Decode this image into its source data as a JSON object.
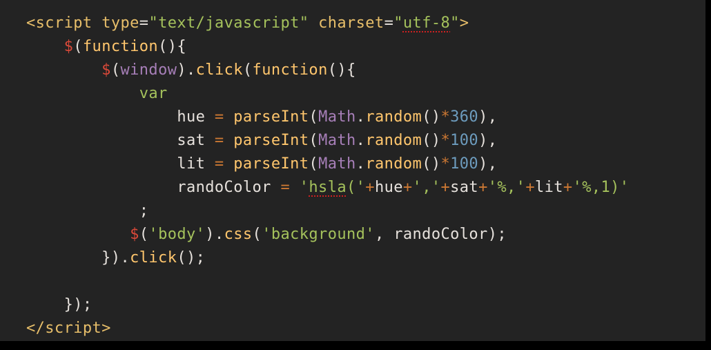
{
  "colors": {
    "window_background": "#232323",
    "outer_background": "#000000",
    "plain_text": "#e6e1dc",
    "tag": "#e8bf6a",
    "string": "#a5c25c",
    "keyword": "#cc7833",
    "number": "#6d9cbe",
    "global": "#a77fb8",
    "spellcheck_underline": "#d02020"
  },
  "lines": [
    [
      {
        "t": "<script",
        "c": "tag"
      },
      {
        "t": " ",
        "c": "plain"
      },
      {
        "t": "type",
        "c": "attr"
      },
      {
        "t": "=",
        "c": "plain"
      },
      {
        "t": "\"text/javascript\"",
        "c": "string"
      },
      {
        "t": " ",
        "c": "plain"
      },
      {
        "t": "charset",
        "c": "attr"
      },
      {
        "t": "=",
        "c": "plain"
      },
      {
        "t": "\"",
        "c": "string"
      },
      {
        "t": "utf-8",
        "c": "string",
        "spell": true
      },
      {
        "t": "\"",
        "c": "string"
      },
      {
        "t": ">",
        "c": "tag"
      }
    ],
    [
      {
        "t": "    ",
        "c": "plain"
      },
      {
        "t": "$",
        "c": "dollar"
      },
      {
        "t": "(",
        "c": "punct"
      },
      {
        "t": "function",
        "c": "func"
      },
      {
        "t": "(){",
        "c": "punct"
      }
    ],
    [
      {
        "t": "        ",
        "c": "plain"
      },
      {
        "t": "$",
        "c": "dollar"
      },
      {
        "t": "(",
        "c": "punct"
      },
      {
        "t": "window",
        "c": "global"
      },
      {
        "t": ").",
        "c": "punct"
      },
      {
        "t": "click",
        "c": "builtin"
      },
      {
        "t": "(",
        "c": "punct"
      },
      {
        "t": "function",
        "c": "func"
      },
      {
        "t": "(){",
        "c": "punct"
      }
    ],
    [
      {
        "t": "            ",
        "c": "plain"
      },
      {
        "t": "var",
        "c": "decl"
      }
    ],
    [
      {
        "t": "                ",
        "c": "plain"
      },
      {
        "t": "hue",
        "c": "var"
      },
      {
        "t": " ",
        "c": "plain"
      },
      {
        "t": "=",
        "c": "op"
      },
      {
        "t": " ",
        "c": "plain"
      },
      {
        "t": "parseInt",
        "c": "builtin"
      },
      {
        "t": "(",
        "c": "punct"
      },
      {
        "t": "Math",
        "c": "global"
      },
      {
        "t": ".",
        "c": "punct"
      },
      {
        "t": "random",
        "c": "builtin"
      },
      {
        "t": "()",
        "c": "punct"
      },
      {
        "t": "*",
        "c": "op"
      },
      {
        "t": "360",
        "c": "number"
      },
      {
        "t": "),",
        "c": "punct"
      }
    ],
    [
      {
        "t": "                ",
        "c": "plain"
      },
      {
        "t": "sat",
        "c": "var"
      },
      {
        "t": " ",
        "c": "plain"
      },
      {
        "t": "=",
        "c": "op"
      },
      {
        "t": " ",
        "c": "plain"
      },
      {
        "t": "parseInt",
        "c": "builtin"
      },
      {
        "t": "(",
        "c": "punct"
      },
      {
        "t": "Math",
        "c": "global"
      },
      {
        "t": ".",
        "c": "punct"
      },
      {
        "t": "random",
        "c": "builtin"
      },
      {
        "t": "()",
        "c": "punct"
      },
      {
        "t": "*",
        "c": "op"
      },
      {
        "t": "100",
        "c": "number"
      },
      {
        "t": "),",
        "c": "punct"
      }
    ],
    [
      {
        "t": "                ",
        "c": "plain"
      },
      {
        "t": "lit",
        "c": "var"
      },
      {
        "t": " ",
        "c": "plain"
      },
      {
        "t": "=",
        "c": "op"
      },
      {
        "t": " ",
        "c": "plain"
      },
      {
        "t": "parseInt",
        "c": "builtin"
      },
      {
        "t": "(",
        "c": "punct"
      },
      {
        "t": "Math",
        "c": "global"
      },
      {
        "t": ".",
        "c": "punct"
      },
      {
        "t": "random",
        "c": "builtin"
      },
      {
        "t": "()",
        "c": "punct"
      },
      {
        "t": "*",
        "c": "op"
      },
      {
        "t": "100",
        "c": "number"
      },
      {
        "t": "),",
        "c": "punct"
      }
    ],
    [
      {
        "t": "                ",
        "c": "plain"
      },
      {
        "t": "randoColor",
        "c": "var"
      },
      {
        "t": " ",
        "c": "plain"
      },
      {
        "t": "=",
        "c": "op"
      },
      {
        "t": " ",
        "c": "plain"
      },
      {
        "t": "'",
        "c": "string"
      },
      {
        "t": "hsla",
        "c": "string",
        "spell": true
      },
      {
        "t": "('",
        "c": "string"
      },
      {
        "t": "+",
        "c": "op"
      },
      {
        "t": "hue",
        "c": "var"
      },
      {
        "t": "+",
        "c": "op"
      },
      {
        "t": "','",
        "c": "string"
      },
      {
        "t": "+",
        "c": "op"
      },
      {
        "t": "sat",
        "c": "var"
      },
      {
        "t": "+",
        "c": "op"
      },
      {
        "t": "'%,'",
        "c": "string"
      },
      {
        "t": "+",
        "c": "op"
      },
      {
        "t": "lit",
        "c": "var"
      },
      {
        "t": "+",
        "c": "op"
      },
      {
        "t": "'%,1)'",
        "c": "string"
      }
    ],
    [
      {
        "t": "            ",
        "c": "plain"
      },
      {
        "t": ";",
        "c": "punct"
      }
    ],
    [
      {
        "t": "           ",
        "c": "plain"
      },
      {
        "t": "$",
        "c": "dollar"
      },
      {
        "t": "(",
        "c": "punct"
      },
      {
        "t": "'body'",
        "c": "string"
      },
      {
        "t": ").",
        "c": "punct"
      },
      {
        "t": "css",
        "c": "builtin"
      },
      {
        "t": "(",
        "c": "punct"
      },
      {
        "t": "'background'",
        "c": "string"
      },
      {
        "t": ", ",
        "c": "punct"
      },
      {
        "t": "randoColor",
        "c": "var"
      },
      {
        "t": ");",
        "c": "punct"
      }
    ],
    [
      {
        "t": "        ",
        "c": "plain"
      },
      {
        "t": "}).",
        "c": "punct"
      },
      {
        "t": "click",
        "c": "builtin"
      },
      {
        "t": "();",
        "c": "punct"
      }
    ],
    [],
    [
      {
        "t": "    ",
        "c": "plain"
      },
      {
        "t": "});",
        "c": "punct"
      }
    ],
    [
      {
        "t": "</script",
        "c": "tag"
      },
      {
        "t": ">",
        "c": "tag"
      }
    ]
  ]
}
